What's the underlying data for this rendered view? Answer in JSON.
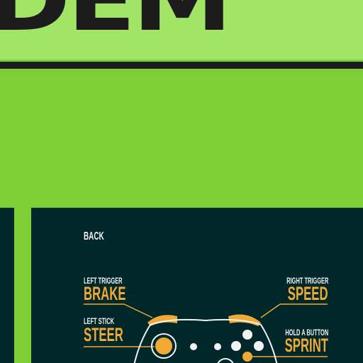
{
  "header": {
    "logo_text": "DEM"
  },
  "controls_screen": {
    "back_label": "BACK",
    "mappings": {
      "left_trigger": {
        "label": "LEFT TRIGGER",
        "action": "BRAKE"
      },
      "left_stick": {
        "label": "LEFT STICK",
        "action": "STEER"
      },
      "right_trigger": {
        "label": "RIGHT TRIGGER",
        "action": "SPEED"
      },
      "hold_a_button": {
        "label": "HOLD A BUTTON",
        "action": "SPRINT"
      }
    }
  },
  "colors": {
    "light_green": "#a2e466",
    "green": "#7ecf35",
    "dark_teal": "#00272a",
    "accent_orange": "#f0a935",
    "near_black": "#1c1c1c"
  },
  "icons": [
    "gamepad-icon"
  ]
}
